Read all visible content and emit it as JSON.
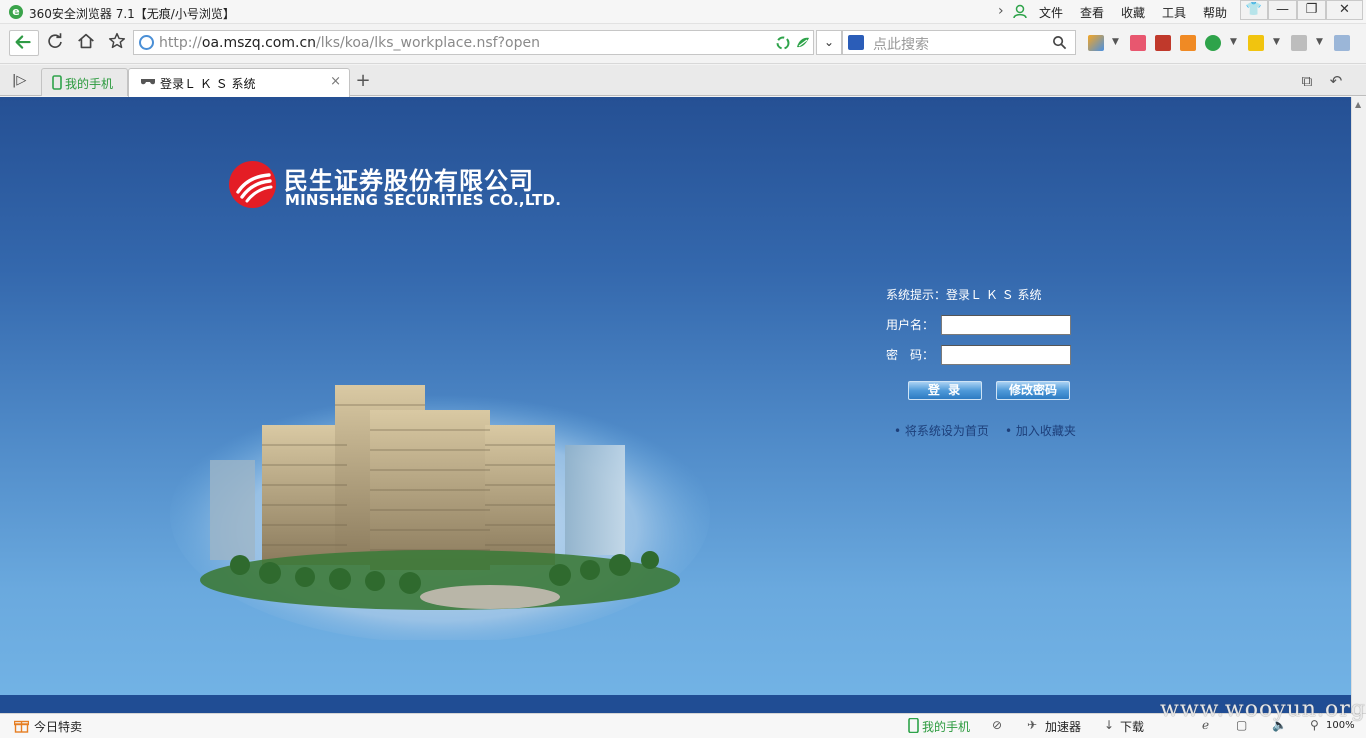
{
  "window": {
    "title": "360安全浏览器 7.1【无痕/小号浏览】",
    "menu": [
      "文件",
      "查看",
      "收藏",
      "工具",
      "帮助"
    ]
  },
  "address_bar": {
    "url_scheme": "http://",
    "url_host": "oa.mszq.com.cn",
    "url_path": "/lks/koa/lks_workplace.nsf?open",
    "search_placeholder": "点此搜索"
  },
  "tabs": [
    {
      "label": "我的手机",
      "active": false
    },
    {
      "label": "登录Ｌ Ｋ Ｓ 系统",
      "active": true
    }
  ],
  "page": {
    "company_name_cn": "民生证券股份有限公司",
    "company_name_en": "MINSHENG SECURITIES CO.,LTD.",
    "login": {
      "hint": "系统提示：登录Ｌ Ｋ Ｓ 系统",
      "username_label": "用户名：",
      "password_label": "密　码：",
      "username_value": "",
      "password_value": "",
      "login_button": "登 录",
      "change_password_button": "修改密码",
      "link_set_homepage": "• 将系统设为首页",
      "link_add_favorite": "• 加入收藏夹"
    }
  },
  "status_bar": {
    "left_item": "今日特卖",
    "phone": "我的手机",
    "accelerator": "加速器",
    "download": "下载",
    "zoom": "100%"
  },
  "watermark": "www.wooyun.org",
  "colors": {
    "page_top": "#255094",
    "page_bottom": "#73b4e6",
    "logo_red": "#e41d25",
    "brand_green": "#3aa34a"
  }
}
